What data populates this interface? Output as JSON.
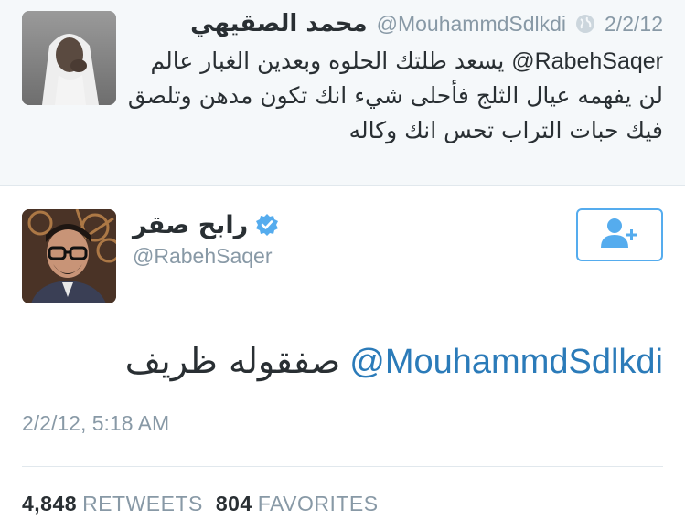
{
  "parent_tweet": {
    "author_name": "محمد الصقيهي",
    "author_handle": "@MouhammdSdlkdi",
    "date": "2/2/12",
    "mention": "@RabehSaqer",
    "text": "يسعد طلتك الحلوه وبعدين الغبار عالم لن يفهمه عيال الثلج فأحلى شيء انك تكون مدهن وتلصق فيك حبات التراب تحس انك وكاله",
    "avatar": "user-photo"
  },
  "tweet": {
    "author_name": "رابح صقر",
    "author_handle": "@RabehSaqer",
    "verified": true,
    "mention": "@MouhammdSdlkdi",
    "text": "صفقوله ظريف",
    "timestamp": "2/2/12, 5:18 AM",
    "avatar": "user-photo"
  },
  "follow_button": {
    "icon": "follow-user-icon"
  },
  "stats": {
    "retweets_count": "4,848",
    "retweets_label": "RETWEETS",
    "favorites_count": "804",
    "favorites_label": "FAVORITES"
  },
  "colors": {
    "link": "#2b7bb9",
    "accent": "#55acee",
    "muted": "#8899a6",
    "parent_bg": "#f5f8fa"
  }
}
